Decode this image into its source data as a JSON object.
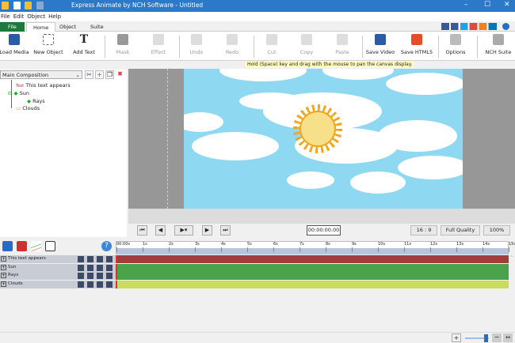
{
  "window": {
    "title": "Express Animate by NCH Software - Untitled",
    "minimize": "–",
    "maximize": "☐",
    "close": "✕"
  },
  "menu": [
    "File",
    "Edit",
    "Object",
    "Help"
  ],
  "tabs": [
    {
      "label": "File"
    },
    {
      "label": "Home",
      "active": true
    },
    {
      "label": "Object"
    },
    {
      "label": "Suite"
    }
  ],
  "ribbon": [
    {
      "label": "Load Media",
      "icon": "load-media-icon",
      "color": "#2a5aa8",
      "enabled": true
    },
    {
      "label": "New Object",
      "icon": "new-object-icon",
      "color": "#cccccc",
      "enabled": true
    },
    {
      "label": "Add Text",
      "icon": "add-text-icon",
      "color": "#333333",
      "enabled": true
    },
    {
      "label": "Mask",
      "icon": "mask-icon",
      "color": "#888888",
      "enabled": false
    },
    {
      "label": "Effect",
      "icon": "effect-icon",
      "color": "#cccccc",
      "enabled": false
    },
    {
      "label": "Undo",
      "icon": "undo-icon",
      "color": "#cccccc",
      "enabled": false
    },
    {
      "label": "Redo",
      "icon": "redo-icon",
      "color": "#cccccc",
      "enabled": false
    },
    {
      "label": "Cut",
      "icon": "cut-icon",
      "color": "#cccccc",
      "enabled": false
    },
    {
      "label": "Copy",
      "icon": "copy-icon",
      "color": "#cccccc",
      "enabled": false
    },
    {
      "label": "Paste",
      "icon": "paste-icon",
      "color": "#cccccc",
      "enabled": false
    },
    {
      "label": "Save Video",
      "icon": "save-video-icon",
      "color": "#2a5aa8",
      "enabled": true
    },
    {
      "label": "Save HTML5",
      "icon": "save-html5-icon",
      "color": "#e44d26",
      "enabled": true
    },
    {
      "label": "Options",
      "icon": "options-icon",
      "color": "#999999",
      "enabled": true
    },
    {
      "label": "NCH Suite",
      "icon": "nch-suite-icon",
      "color": "#888888",
      "enabled": true
    }
  ],
  "hint": "Hold (Space) key and drag with the mouse to pan the canvas display.",
  "composition": {
    "selected": "Main Composition"
  },
  "tree": [
    {
      "label": "This text appears",
      "badge": "Text",
      "depth": 1
    },
    {
      "label": "Sun",
      "depth": 1
    },
    {
      "label": "Rays",
      "depth": 2
    },
    {
      "label": "Clouds",
      "depth": 1
    }
  ],
  "playback": {
    "time": "00:00:00.00",
    "aspect": "16 : 9",
    "quality": "Full Quality",
    "zoom": "100%"
  },
  "ruler": [
    "00:00s",
    "1s",
    "2s",
    "3s",
    "4s",
    "5s",
    "6s",
    "7s",
    "8s",
    "9s",
    "10s",
    "11s",
    "12s",
    "13s",
    "14s",
    "15s"
  ],
  "tracks": [
    {
      "label": "This text appears",
      "color": "#a33c3c"
    },
    {
      "label": "Sun",
      "color": "#4aa34a"
    },
    {
      "label": "Rays",
      "color": "#4aa34a"
    },
    {
      "label": "Clouds",
      "color": "#c9dc5c"
    }
  ],
  "zoomctl": {
    "plus": "+",
    "minus": "−",
    "fit": "↔",
    "level": 0.85
  }
}
